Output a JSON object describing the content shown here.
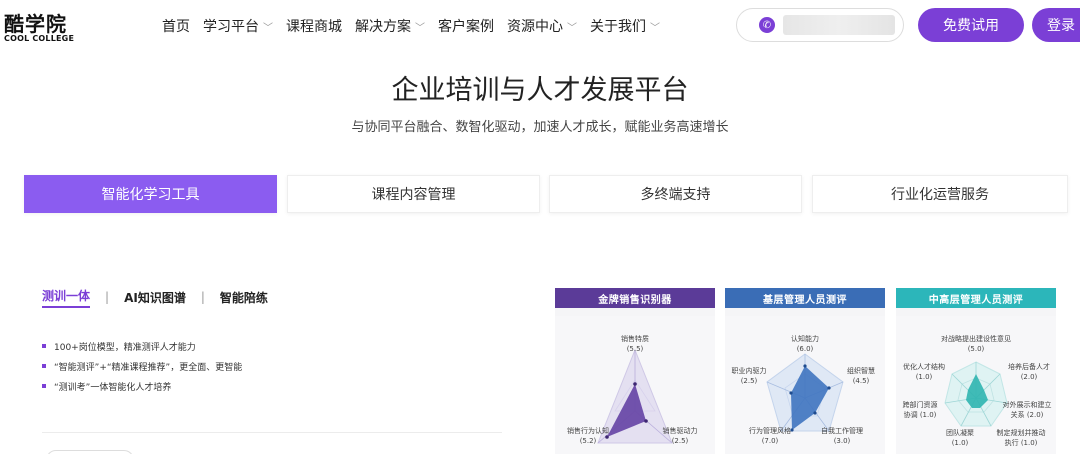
{
  "brand": {
    "name": "酷学院",
    "sub": "COOL COLLEGE"
  },
  "nav": {
    "items": [
      {
        "label": "首页",
        "dropdown": false
      },
      {
        "label": "学习平台",
        "dropdown": true
      },
      {
        "label": "课程商城",
        "dropdown": false
      },
      {
        "label": "解决方案",
        "dropdown": true
      },
      {
        "label": "客户案例",
        "dropdown": false
      },
      {
        "label": "资源中心",
        "dropdown": true
      },
      {
        "label": "关于我们",
        "dropdown": true
      }
    ],
    "trial_label": "免费试用",
    "login_label": "登录"
  },
  "hero": {
    "title": "企业培训与人才发展平台",
    "subtitle": "与协同平台融合、数智化驱动，加速人才成长，赋能业务高速增长"
  },
  "tabs": [
    {
      "label": "智能化学习工具",
      "active": true
    },
    {
      "label": "课程内容管理",
      "active": false
    },
    {
      "label": "多终端支持",
      "active": false
    },
    {
      "label": "行业化运营服务",
      "active": false
    }
  ],
  "subtabs": [
    {
      "label": "测训一体",
      "active": true
    },
    {
      "label": "AI知识图谱",
      "active": false
    },
    {
      "label": "智能陪练",
      "active": false
    }
  ],
  "features": [
    "100+岗位模型，精准测评人才能力",
    "“智能测评”+“精准课程推荐”，更全面、更智能",
    "“测训考”一体智能化人才培养"
  ],
  "cards": [
    {
      "title": "金牌销售识别器",
      "color": "#5b3b98",
      "fill": "#6a4aa8",
      "labels": [
        {
          "name": "销售特质",
          "value": "(5.5)"
        },
        {
          "name": "销售驱动力",
          "value": "(2.5)"
        },
        {
          "name": "销售行为认知",
          "value": "(5.2)"
        }
      ]
    },
    {
      "title": "基层管理人员测评",
      "color": "#3a6db6",
      "fill": "#3f74c0",
      "labels": [
        {
          "name": "认知能力",
          "value": "(6.0)"
        },
        {
          "name": "组织智慧",
          "value": "(4.5)"
        },
        {
          "name": "自我工作管理",
          "value": "(3.0)"
        },
        {
          "name": "行为管理风格",
          "value": "(7.0)"
        },
        {
          "name": "职业内驱力",
          "value": "(2.5)"
        }
      ]
    },
    {
      "title": "中高层管理人员测评",
      "color": "#2cb6ba",
      "fill": "#2fb5b0",
      "labels": [
        {
          "name": "对战略提出建设性意见",
          "value": "(5.0)"
        },
        {
          "name": "培养后备人才",
          "value": "(2.0)"
        },
        {
          "name": "对外展示和建立关系",
          "value": "(2.0)"
        },
        {
          "name": "制定规划并推动执行",
          "value": "(1.0)"
        },
        {
          "name": "团队凝聚",
          "value": "(1.0)"
        },
        {
          "name": "跨部门资源协调",
          "value": "(1.0)"
        },
        {
          "name": "优化人才结构",
          "value": "(1.0)"
        }
      ]
    }
  ]
}
